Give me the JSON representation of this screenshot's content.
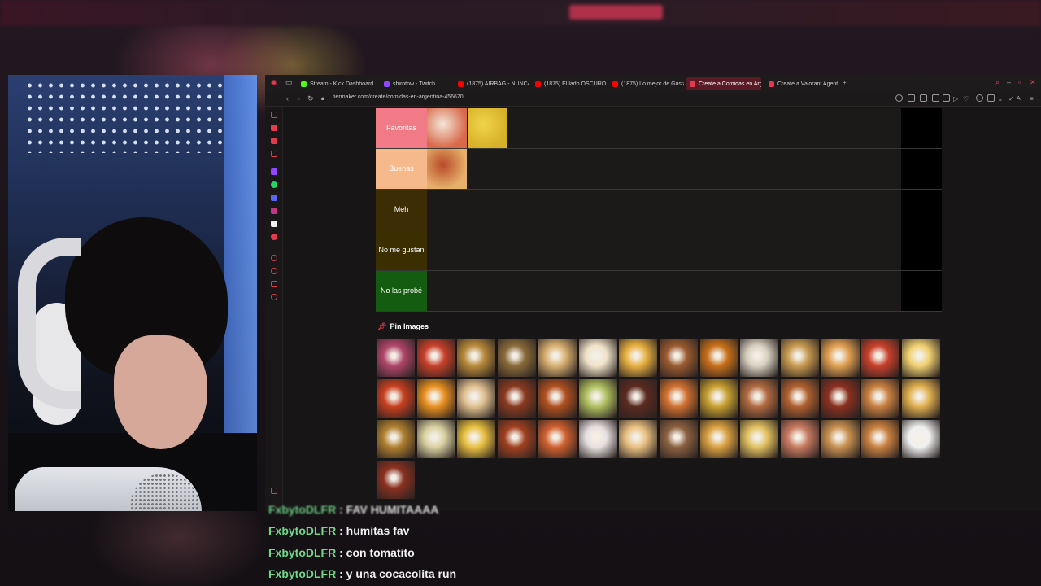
{
  "browser": {
    "tabs": [
      {
        "label": "Stream - Kick Dashboard",
        "color": "#53fc18"
      },
      {
        "label": "shirotnw - Twitch",
        "color": "#9146ff"
      },
      {
        "label": "(1875) AIRBAG - NUNCA",
        "color": "#ff0000"
      },
      {
        "label": "(1875) El lado OSCURO de",
        "color": "#ff0000"
      },
      {
        "label": "(1875) Lo mejor de Gusta",
        "color": "#ff0000"
      },
      {
        "label": "Create a Comidas en Arg",
        "color": "#e23b4f"
      },
      {
        "label": "Create a Valorant Agents",
        "color": "#e23b4f"
      }
    ],
    "new_tab": "+",
    "url": "tiermaker.com/create/comidas-en-argentina-456670",
    "extension_label": "AI"
  },
  "tiers": [
    {
      "label": "Favoritas",
      "color": "#f07a86"
    },
    {
      "label": "Buenas",
      "color": "#f6b98b"
    },
    {
      "label": "Meh",
      "color": "#3d2d05"
    },
    {
      "label": "No me gustan",
      "color": "#3b2e00"
    },
    {
      "label": "No las probé",
      "color": "#145c10"
    }
  ],
  "pin_images": {
    "title": "Pin Images",
    "icon": "pin-icon"
  },
  "chat": [
    {
      "user": "FxbytoDLFR",
      "text": "FAV HUMITAAAA",
      "partial": true
    },
    {
      "user": "FxbytoDLFR",
      "text": "humitas fav"
    },
    {
      "user": "FxbytoDLFR",
      "text": "con tomatito"
    },
    {
      "user": "FxbytoDLFR",
      "text": "y una cocacolita run"
    }
  ]
}
